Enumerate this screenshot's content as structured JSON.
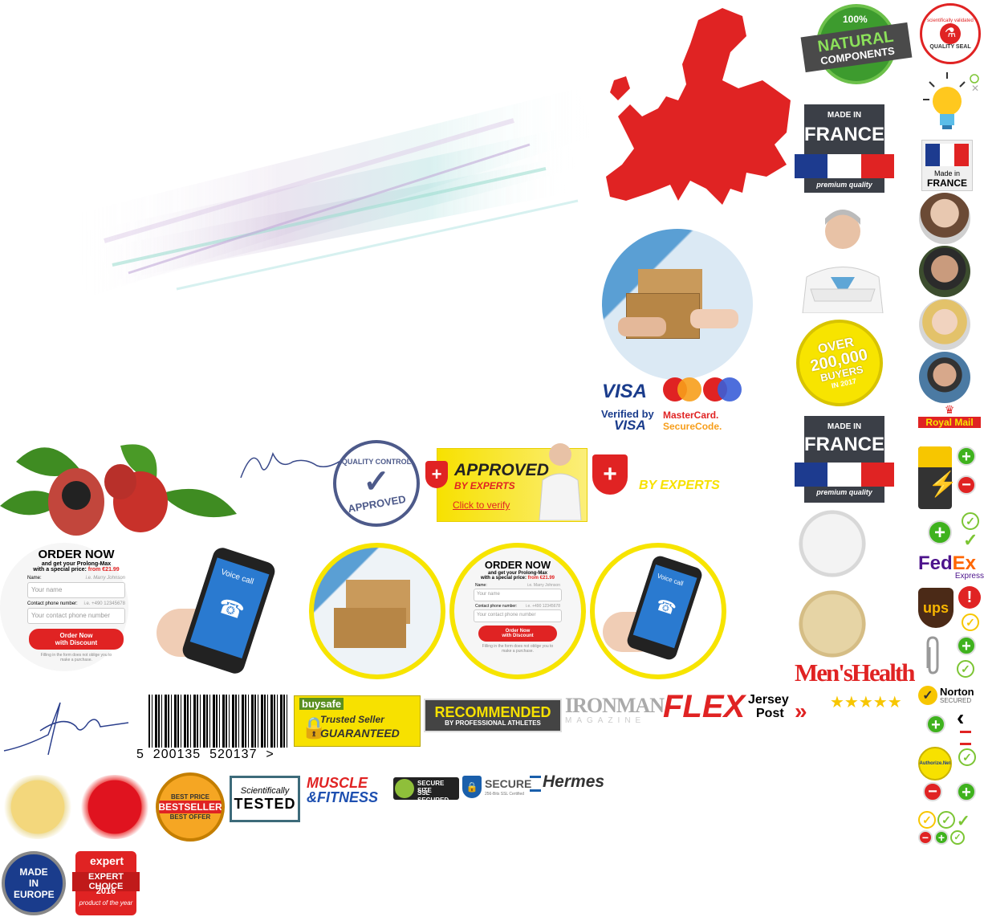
{
  "seals": {
    "natural": {
      "line1": "100%",
      "line2": "NATURAL",
      "line3": "COMPONENTS"
    },
    "quality_seal": {
      "ring": "scientifically validated",
      "bottom": "QUALITY SEAL"
    },
    "made_in_france_large": {
      "made_in": "MADE IN",
      "country": "FRANCE",
      "ribbon": "premium quality"
    },
    "made_in_france_small": {
      "made_in": "Made in",
      "country": "FRANCE"
    },
    "over_buyers": {
      "line1": "OVER",
      "line2": "200,000",
      "line3": "BUYERS",
      "line4": "IN 2017"
    },
    "made_in_france_second": {
      "made_in": "MADE IN",
      "country": "FRANCE",
      "ribbon": "premium quality"
    },
    "royal_mail": "Royal Mail",
    "fedex": {
      "fed": "Fed",
      "ex": "Ex",
      "express": "Express"
    },
    "ups": "ups",
    "norton": {
      "name": "Norton",
      "secured": "SECURED"
    },
    "authorize": "Authorize.Net",
    "quality_control": {
      "top": "QUALITY CONTROL",
      "bottom": "APPROVED"
    },
    "approved_experts": {
      "title": "APPROVED",
      "subtitle": "BY EXPERTS",
      "link": "Click to verify"
    },
    "by_experts": "BY EXPERTS",
    "buysafe": {
      "logo": "buysafe",
      "line1": "Trusted Seller",
      "line2": "GUARANTEED"
    },
    "recommended": {
      "line1": "RECOMMENDED",
      "line2": "BY PROFESSIONAL ATHLETES"
    },
    "ironman": {
      "title": "IRONMAN",
      "sub": "MAGAZINE"
    },
    "flex": "FLEX",
    "jersey_post": {
      "line1": "Jersey",
      "line2": "Post"
    },
    "stars": "★★★★★",
    "mens_health": "Men'sHealth",
    "best_price": {
      "top": "BEST PRICE",
      "middle": "BESTSELLER",
      "bottom": "BEST OFFER"
    },
    "sci_tested": {
      "line1": "Scientifically",
      "line2": "TESTED"
    },
    "muscle_fitness": {
      "line1": "MUSCLE",
      "line2": "&FITNESS"
    },
    "secure_site": {
      "line1": "SECURE SITE",
      "line2": "SSL SECURED"
    },
    "secure": {
      "title": "SECURE",
      "sub": "256-Bits SSL Certified"
    },
    "hermes": "Hermes",
    "made_in_europe": "MADE IN EUROPE",
    "expert_choice": {
      "brand": "expert",
      "title": "EXPERT CHOICE",
      "year": "2016",
      "sub": "product of the year"
    }
  },
  "payment": {
    "visa": "VISA",
    "verified_by": "Verified by",
    "verified_visa": "VISA",
    "mastercard": "MasterCard.",
    "securecode": "SecureCode."
  },
  "order_form": {
    "title": "ORDER NOW",
    "line1": "and get your Prolong-Max",
    "line2": "with a special price:",
    "price": "from €21.99",
    "name_label": "Name:",
    "name_hint": "i.e. Marry Johnson",
    "name_placeholder": "Your name",
    "phone_label": "Contact phone number:",
    "phone_hint": "i.e. +490 12345678",
    "phone_placeholder": "Your contact phone number",
    "button_line1": "Order Now",
    "button_line2": "with Discount",
    "footer_line1": "Filling in the form does not oblige you to",
    "footer_line2": "make a purchase."
  },
  "phone": {
    "label": "Voice call"
  },
  "barcode": {
    "digits": "5  200135  520137  >"
  },
  "colors": {
    "red": "#e02323",
    "yellow_ring": "#f7e400",
    "green": "#3fb21e",
    "france_blue": "#1d3b8f"
  }
}
